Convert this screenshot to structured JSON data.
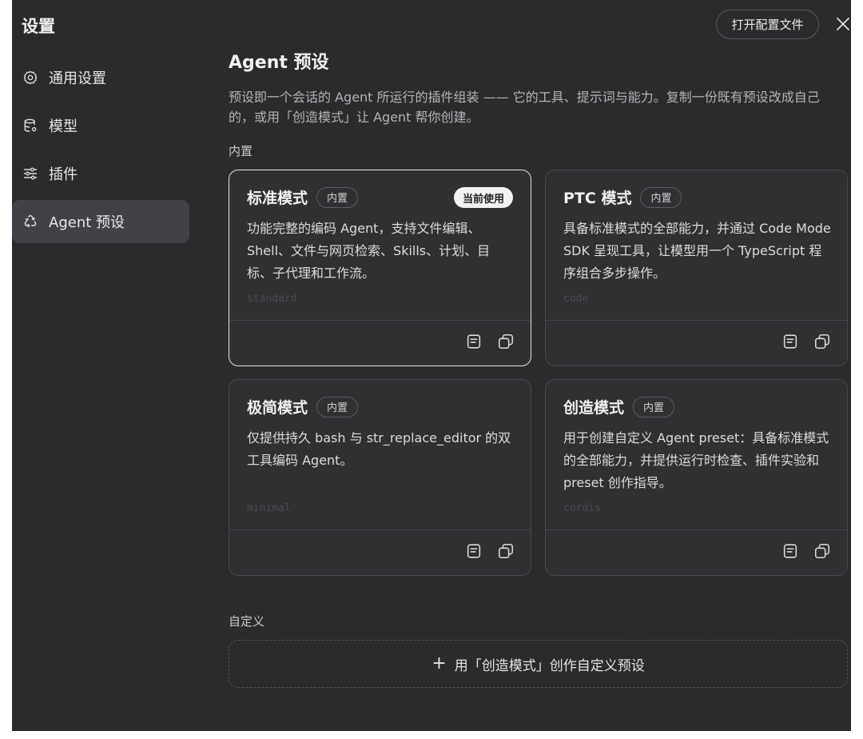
{
  "window": {
    "title": "设置"
  },
  "toolbar": {
    "open_config_label": "打开配置文件"
  },
  "sidebar": {
    "items": [
      {
        "label": "通用设置",
        "icon": "gear-icon"
      },
      {
        "label": "模型",
        "icon": "database-icon"
      },
      {
        "label": "插件",
        "icon": "sliders-icon"
      },
      {
        "label": "Agent 预设",
        "icon": "recycle-icon",
        "active": true
      }
    ]
  },
  "main": {
    "heading": "Agent 预设",
    "description": "预设即一个会话的 Agent 所运行的插件组装 —— 它的工具、提示词与能力。复制一份既有预设改成自己的，或用「创造模式」让 Agent 帮你创建。",
    "builtin_label": "内置",
    "custom_label": "自定义",
    "create_button_label": "用「创造模式」创作自定义预设",
    "current_badge": "当前使用",
    "presets": [
      {
        "name": "标准模式",
        "badge": "内置",
        "description": "功能完整的编码 Agent，支持文件编辑、Shell、文件与网页检索、Skills、计划、目标、子代理和工作流。",
        "id": "standard",
        "selected": true
      },
      {
        "name": "PTC 模式",
        "badge": "内置",
        "description": "具备标准模式的全部能力，并通过 Code Mode SDK 呈现工具，让模型用一个 TypeScript 程序组合多步操作。",
        "id": "code",
        "selected": false
      },
      {
        "name": "极简模式",
        "badge": "内置",
        "description": "仅提供持久 bash 与 str_replace_editor 的双工具编码 Agent。",
        "id": "minimal",
        "selected": false
      },
      {
        "name": "创造模式",
        "badge": "内置",
        "description": "用于创建自定义 Agent preset：具备标准模式的全部能力，并提供运行时检查、插件实验和 preset 创作指导。",
        "id": "cordis",
        "selected": false
      }
    ]
  }
}
